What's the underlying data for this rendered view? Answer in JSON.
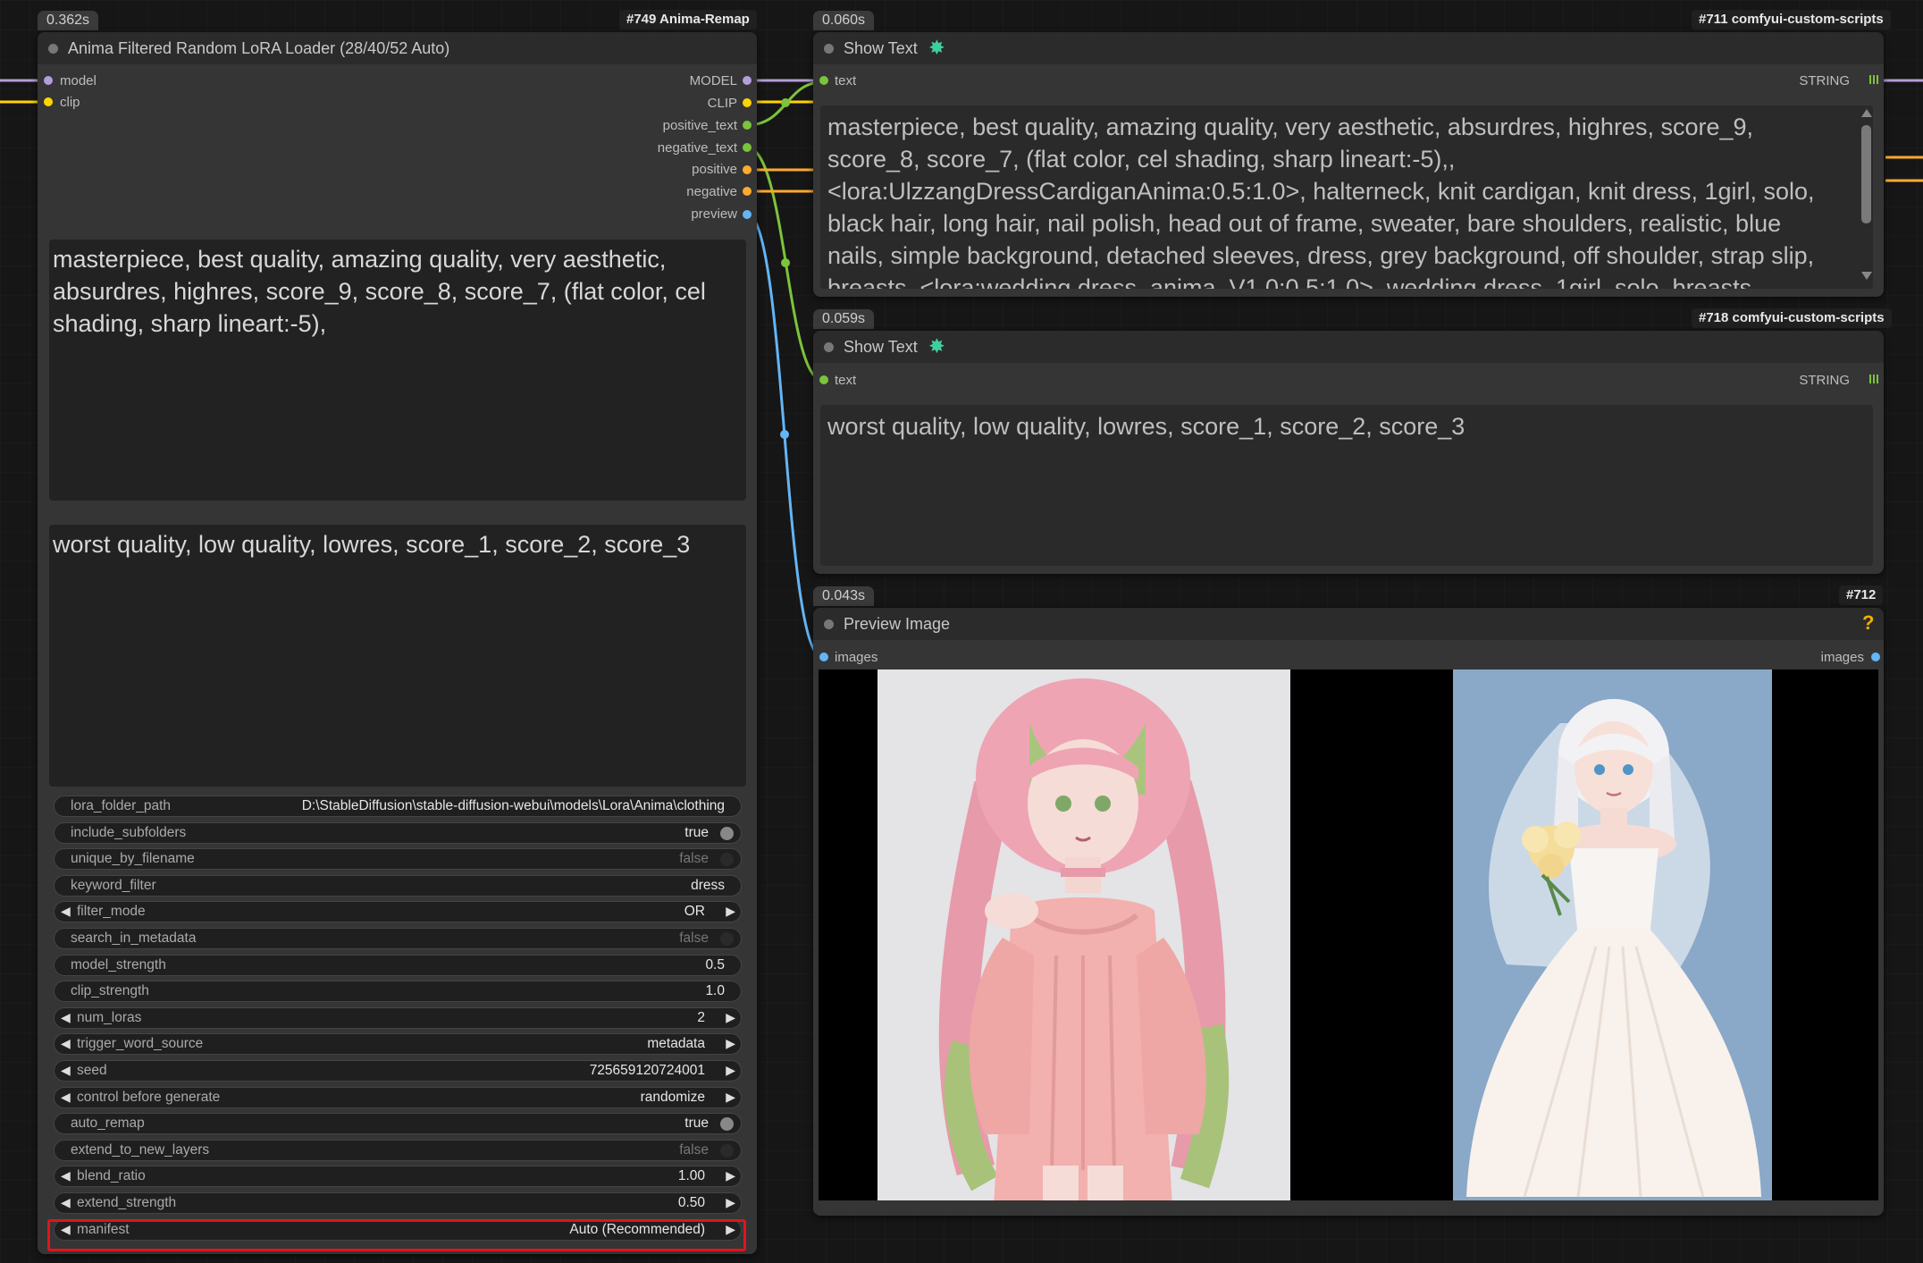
{
  "nodes": {
    "loader": {
      "time": "0.362s",
      "tag": "#749 Anima-Remap",
      "title": "Anima Filtered Random LoRA Loader (28/40/52 Auto)",
      "inputs": [
        "model",
        "clip"
      ],
      "outputs": [
        "MODEL",
        "CLIP",
        "positive_text",
        "negative_text",
        "positive",
        "negative",
        "preview"
      ],
      "positive_prompt": "masterpiece, best quality, amazing quality, very aesthetic, absurdres, highres, score_9, score_8, score_7, (flat color, cel shading, sharp lineart:-5),",
      "negative_prompt": "worst quality, low quality, lowres, score_1, score_2, score_3",
      "widgets": [
        {
          "label": "lora_folder_path",
          "value": "D:\\StableDiffusion\\stable-diffusion-webui\\models\\Lora\\Anima\\clothing",
          "kind": "text"
        },
        {
          "label": "include_subfolders",
          "value": "true",
          "kind": "toggle-on"
        },
        {
          "label": "unique_by_filename",
          "value": "false",
          "kind": "toggle-off"
        },
        {
          "label": "keyword_filter",
          "value": "dress",
          "kind": "text"
        },
        {
          "label": "filter_mode",
          "value": "OR",
          "kind": "combo"
        },
        {
          "label": "search_in_metadata",
          "value": "false",
          "kind": "toggle-off"
        },
        {
          "label": "model_strength",
          "value": "0.5",
          "kind": "text"
        },
        {
          "label": "clip_strength",
          "value": "1.0",
          "kind": "text"
        },
        {
          "label": "num_loras",
          "value": "2",
          "kind": "combo"
        },
        {
          "label": "trigger_word_source",
          "value": "metadata",
          "kind": "combo"
        },
        {
          "label": "seed",
          "value": "725659120724001",
          "kind": "combo"
        },
        {
          "label": "control before generate",
          "value": "randomize",
          "kind": "combo"
        },
        {
          "label": "auto_remap",
          "value": "true",
          "kind": "toggle-on"
        },
        {
          "label": "extend_to_new_layers",
          "value": "false",
          "kind": "toggle-off"
        },
        {
          "label": "blend_ratio",
          "value": "1.00",
          "kind": "combo"
        },
        {
          "label": "extend_strength",
          "value": "0.50",
          "kind": "combo"
        },
        {
          "label": "manifest",
          "value": "Auto (Recommended)",
          "kind": "combo"
        }
      ]
    },
    "show1": {
      "time": "0.060s",
      "tag": "#711 comfyui-custom-scripts",
      "title": "Show Text",
      "input": "text",
      "output": "STRING",
      "content": "masterpiece, best quality, amazing quality, very aesthetic, absurdres, highres, score_9, score_8, score_7, (flat color, cel shading, sharp lineart:-5),, <lora:UlzzangDressCardiganAnima:0.5:1.0>, halterneck, knit cardigan, knit dress, 1girl, solo, black hair, long hair, nail polish, head out of frame, sweater, bare shoulders, realistic, blue nails, simple background, detached sleeves, dress, grey background, off shoulder, strap slip, breasts, <lora:wedding dress_anima_V1.0:0.5:1.0>, wedding dress, 1girl, solo, breasts, looking at viewer, smile, short hair, blue eyes, black hair, hair ornament"
    },
    "show2": {
      "time": "0.059s",
      "tag": "#718 comfyui-custom-scripts",
      "title": "Show Text",
      "input": "text",
      "output": "STRING",
      "content": "worst quality, low quality, lowres, score_1, score_2, score_3"
    },
    "preview": {
      "time": "0.043s",
      "tag": "#712",
      "title": "Preview Image",
      "input": "images",
      "output": "images",
      "help": "?"
    }
  },
  "colors": {
    "model": "#b39ddb",
    "clip": "#ffd500",
    "string": "#7cc43b",
    "conditioning": "#ffa931",
    "image": "#64b5f6",
    "highlight": "#e0141c"
  }
}
